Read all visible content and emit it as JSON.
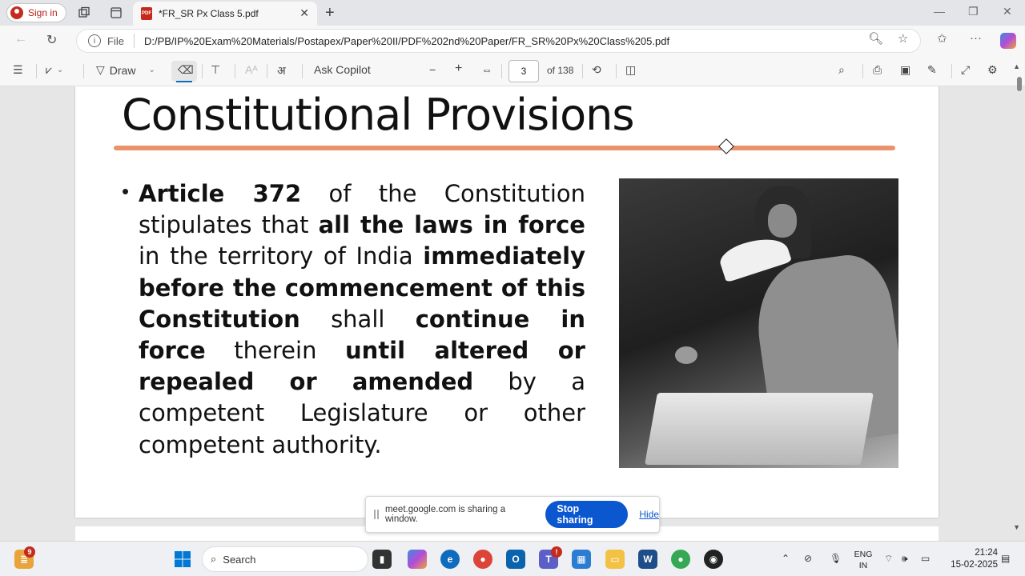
{
  "browser": {
    "sign_in": "Sign in",
    "tab_title": "*FR_SR Px Class 5.pdf",
    "pdf_icon_text": "PDF",
    "new_tab": "+",
    "url_scheme": "File",
    "url": "D:/PB/IP%20Exam%20Materials/Postapex/Paper%20II/PDF%202nd%20Paper/FR_SR%20Px%20Class%205.pdf"
  },
  "pdf_toolbar": {
    "draw_label": "Draw",
    "ask_copilot": "Ask Copilot",
    "zoom_out": "−",
    "zoom_in": "+",
    "current_page": "3",
    "page_total": "of 138"
  },
  "slide": {
    "title": "Constitutional Provisions",
    "bullet": "•",
    "body": [
      {
        "text": "Article 372",
        "bold": true
      },
      {
        "text": " of the Constitution stipulates that ",
        "bold": false
      },
      {
        "text": "all the laws in force",
        "bold": true
      },
      {
        "text": " in the territory of India ",
        "bold": false
      },
      {
        "text": "immediately before the commencement of this Constitution",
        "bold": true
      },
      {
        "text": " shall ",
        "bold": false
      },
      {
        "text": "continue in force",
        "bold": true
      },
      {
        "text": " therein ",
        "bold": false
      },
      {
        "text": "until altered or repealed or amended",
        "bold": true
      },
      {
        "text": " by a competent Legislature or other competent authority.",
        "bold": false
      }
    ],
    "ink_color": "#e8865c"
  },
  "sharing_banner": {
    "message": "meet.google.com is sharing a window.",
    "stop_button": "Stop sharing",
    "hide_link": "Hide"
  },
  "taskbar": {
    "widgets_badge": "9",
    "search_placeholder": "Search",
    "lang_line1": "ENG",
    "lang_line2": "IN",
    "time": "21:24",
    "date": "15-02-2025"
  },
  "colors": {
    "accent": "#0b57d0",
    "edge_accent": "#0f6cbd",
    "pdf_red": "#c7281c"
  }
}
